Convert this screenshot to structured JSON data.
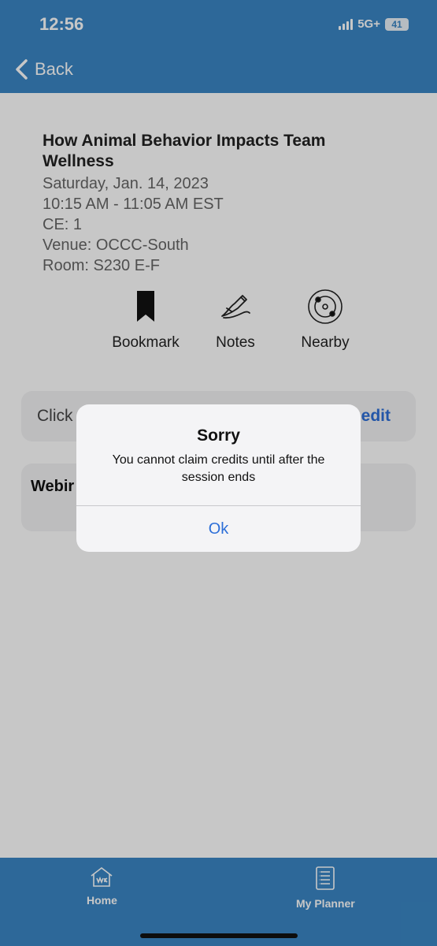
{
  "status_bar": {
    "time": "12:56",
    "network": "5G+",
    "battery": "41"
  },
  "nav": {
    "back_label": "Back"
  },
  "session": {
    "title": "How Animal Behavior Impacts Team Wellness",
    "date": "Saturday, Jan. 14, 2023",
    "time": "10:15 AM - 11:05 AM EST",
    "ce": "CE: 1",
    "venue": "Venue: OCCC-South",
    "room": "Room: S230 E-F"
  },
  "actions": [
    {
      "label": "Bookmark",
      "icon": "bookmark-icon"
    },
    {
      "label": "Notes",
      "icon": "notes-icon"
    },
    {
      "label": "Nearby",
      "icon": "nearby-icon"
    }
  ],
  "claim_card": {
    "left_text": "Click",
    "right_text": "edit"
  },
  "webinar_card": {
    "left_text": "Webir"
  },
  "alert": {
    "title": "Sorry",
    "message": "You cannot claim credits until after the session ends",
    "ok_label": "Ok"
  },
  "tabbar": [
    {
      "label": "Home",
      "icon": "home-icon"
    },
    {
      "label": "My Planner",
      "icon": "planner-icon"
    }
  ],
  "colors": {
    "brand": "#3a86c4",
    "link": "#2d6fd8",
    "overlay": "rgba(0,0,0,0.22)"
  }
}
